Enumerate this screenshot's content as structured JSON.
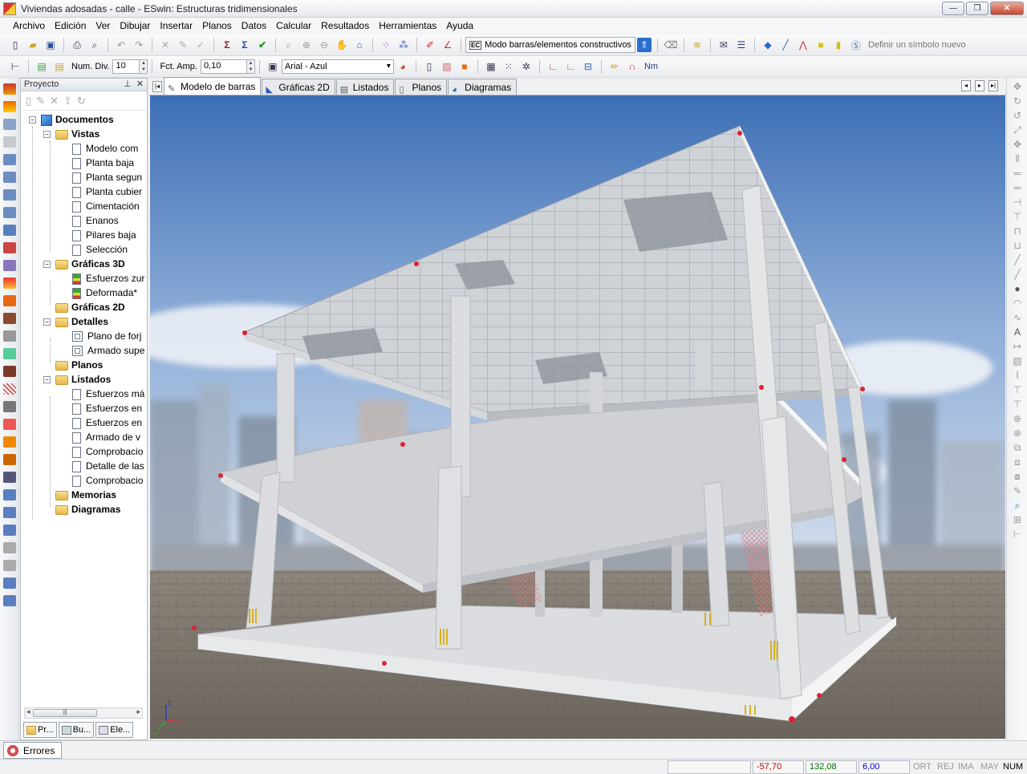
{
  "window": {
    "title": "Viviendas adosadas - calle - ESwin: Estructuras tridimensionales",
    "buttons": {
      "minimize": "—",
      "maximize": "❐",
      "close": "✕"
    }
  },
  "menu": [
    "Archivo",
    "Edición",
    "Ver",
    "Dibujar",
    "Insertar",
    "Planos",
    "Datos",
    "Calcular",
    "Resultados",
    "Herramientas",
    "Ayuda"
  ],
  "toolbar1": {
    "mode_button_label": "Modo barras/elementos constructivos",
    "symbol_label": "Definir un símbolo nuevo"
  },
  "toolbar2": {
    "num_div_label": "Num. Div.",
    "num_div_value": "10",
    "fct_amp_label": "Fct. Amp.",
    "fct_amp_value": "0,10",
    "font_select": "Arial - Azul",
    "nm_label": "Nm"
  },
  "project_panel": {
    "title": "Proyecto",
    "tree": {
      "root": "Documentos",
      "vistas": "Vistas",
      "vistas_items": [
        "Modelo com",
        "Planta baja",
        "Planta segun",
        "Planta cubier",
        "Cimentación",
        "Enanos",
        "Pilares baja",
        "Selección"
      ],
      "graficas3d": "Gráficas 3D",
      "graficas3d_items": [
        "Esfuerzos zur",
        "Deformada*"
      ],
      "graficas2d": "Gráficas 2D",
      "detalles": "Detalles",
      "detalles_items": [
        "Plano de forj",
        "Armado supe"
      ],
      "planos": "Planos",
      "listados": "Listados",
      "listados_items": [
        "Esfuerzos má",
        "Esfuerzos en",
        "Esfuerzos en",
        "Armado de v",
        "Comprobacio",
        "Detalle de las",
        "Comprobacio"
      ],
      "memorias": "Memorias",
      "diagramas": "Diagramas"
    },
    "bottom_tabs": [
      "Pr...",
      "Bu...",
      "Ele..."
    ]
  },
  "doc_tabs": [
    "Modelo de barras",
    "Gráficas 2D",
    "Listados",
    "Planos",
    "Diagramas"
  ],
  "viewport": {
    "axis_labels": {
      "x": "x",
      "y": "y",
      "z": "z"
    }
  },
  "errors_tab": "Errores",
  "status": {
    "x": "-57,70",
    "y": "132,08",
    "z": "6,00",
    "flags": [
      "ORT",
      "REJ",
      "IMA",
      "MAY",
      "NUM"
    ],
    "colors": {
      "x": "#c00000",
      "y": "#007000",
      "z": "#0000c0"
    }
  },
  "colors": {
    "sky_top": "#3d6fb6",
    "sky_bottom": "#c9d7ea",
    "ground": "#7d776e",
    "structure": "#d9dadc"
  }
}
